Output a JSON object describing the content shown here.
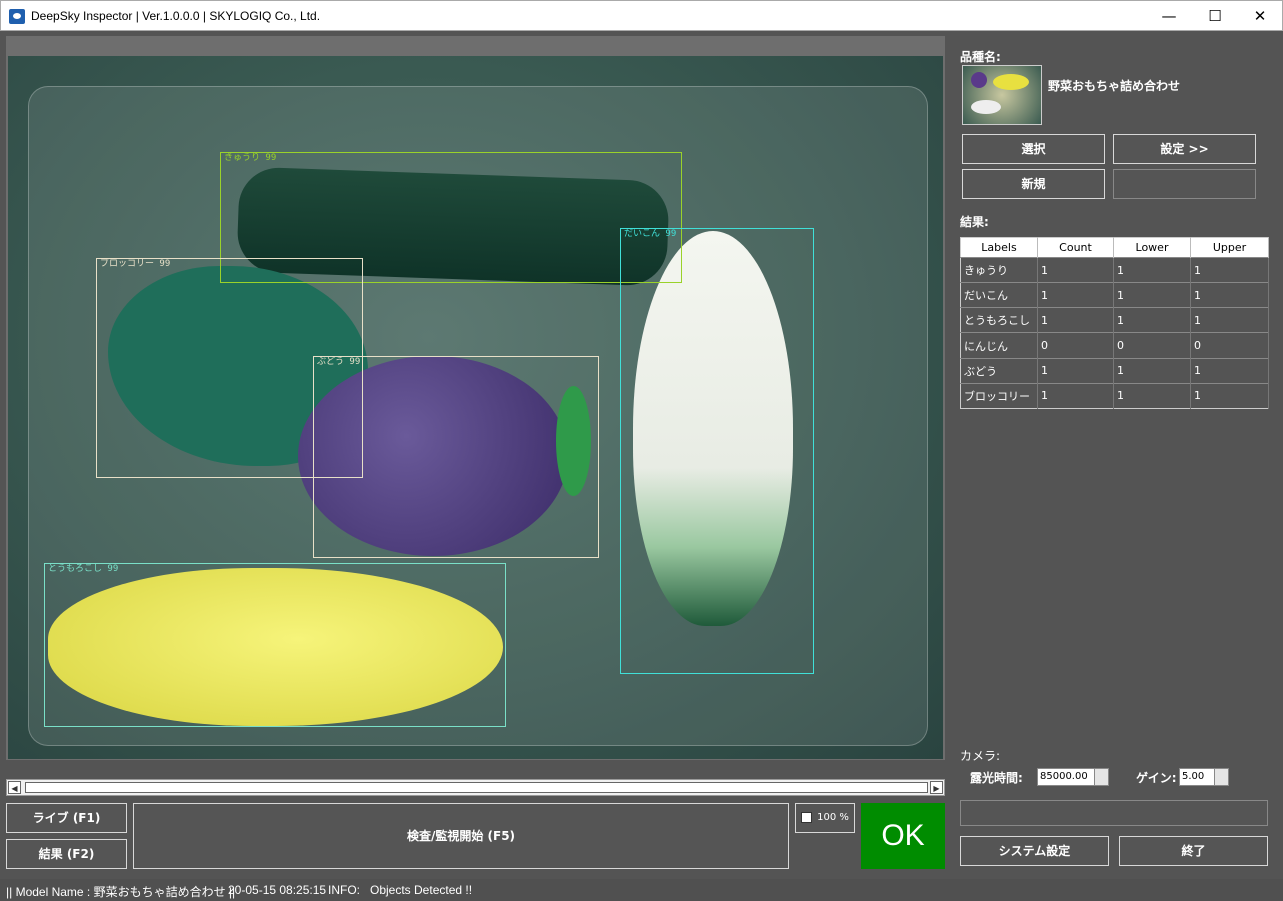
{
  "window": {
    "title": "DeepSky Inspector | Ver.1.0.0.0 | SKYLOGIQ Co., Ltd.",
    "min": "—",
    "max": "☐",
    "close": "✕"
  },
  "detections": [
    {
      "label": "きゅうり 99",
      "color": "#9ad22a"
    },
    {
      "label": "ブロッコリー 99",
      "color": "#e8e0c8"
    },
    {
      "label": "ぶどう 99",
      "color": "#e8e0c8"
    },
    {
      "label": "だいこん 99",
      "color": "#40e0d8"
    },
    {
      "label": "とうもろこし 99",
      "color": "#7ae0c8"
    }
  ],
  "controls": {
    "live": "ライブ (F1)",
    "result": "結果 (F2)",
    "inspect": "検査/監視開始 (F5)",
    "zoom": "100 %",
    "verdict": "OK",
    "verdict_color": "#008c00"
  },
  "panel": {
    "product_label": "品種名:",
    "product_name": "野菜おもちゃ詰め合わせ",
    "select": "選択",
    "settings": "設定 >>",
    "new": "新規",
    "results_label": "結果:",
    "columns": [
      "Labels",
      "Count",
      "Lower",
      "Upper"
    ],
    "rows": [
      [
        "きゅうり",
        "1",
        "1",
        "1"
      ],
      [
        "だいこん",
        "1",
        "1",
        "1"
      ],
      [
        "とうもろこし",
        "1",
        "1",
        "1"
      ],
      [
        "にんじん",
        "0",
        "0",
        "0"
      ],
      [
        "ぶどう",
        "1",
        "1",
        "1"
      ],
      [
        "ブロッコリー",
        "1",
        "1",
        "1"
      ]
    ],
    "camera_label": "カメラ:",
    "exposure_label": "露光時間:",
    "exposure_value": "85000.00",
    "gain_label": "ゲイン:",
    "gain_value": "5.00",
    "system": "システム設定",
    "exit": "終了"
  },
  "status": {
    "model": "|| Model Name : 野菜おもちゃ詰め合わせ ||",
    "time": "20-05-15 08:25:15",
    "info": "INFO:   Objects Detected !!"
  }
}
